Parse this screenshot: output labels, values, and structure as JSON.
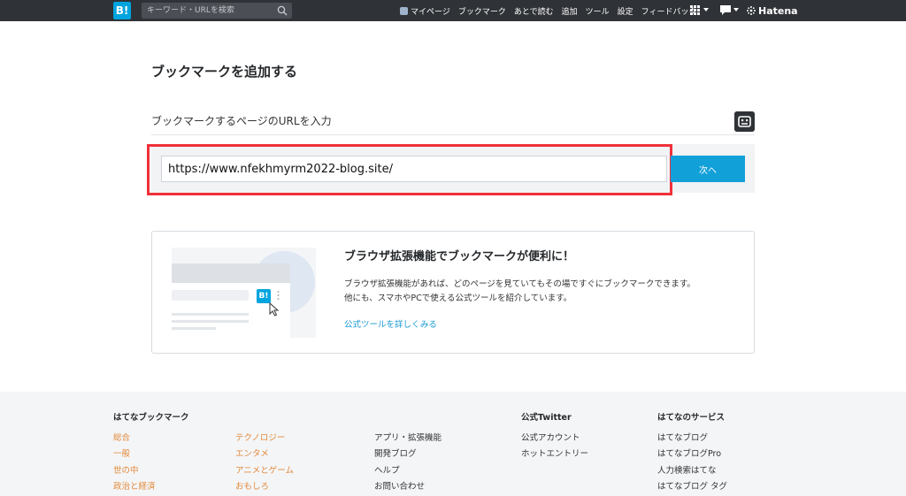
{
  "header": {
    "logo": "B!",
    "search_placeholder": "キーワード・URLを検索",
    "nav": [
      "マイページ",
      "ブックマーク",
      "あとで読む",
      "追加",
      "ツール",
      "設定",
      "フィードバック"
    ],
    "brand": "Hatena"
  },
  "main": {
    "title": "ブックマークを追加する",
    "url_label": "ブックマークするページのURLを入力",
    "url_value": "https://www.nfekhmyrm2022-blog.site/",
    "next_label": "次へ"
  },
  "promo": {
    "title": "ブラウザ拡張機能でブックマークが便利に！",
    "desc_line1": "ブラウザ拡張機能があれば、どのページを見ていてもその場ですぐにブックマークできます。",
    "desc_line2": "他にも、スマホやPCで使える公式ツールを紹介しています。",
    "link": "公式ツールを詳しくみる",
    "illust_badge": "B!"
  },
  "footer": {
    "col1_heading": "はてなブックマーク",
    "col1a": [
      "総合",
      "一般",
      "世の中",
      "政治と経済"
    ],
    "col1b": [
      "テクノロジー",
      "エンタメ",
      "アニメとゲーム",
      "おもしろ"
    ],
    "col2": [
      "アプリ・拡張機能",
      "開発ブログ",
      "ヘルプ",
      "お問い合わせ"
    ],
    "twitter_heading": "公式Twitter",
    "twitter": [
      "公式アカウント",
      "ホットエントリー"
    ],
    "services_heading": "はてなのサービス",
    "services": [
      "はてなブログ",
      "はてなブログPro",
      "人力検索はてな",
      "はてなブログ タグ"
    ]
  },
  "colors": {
    "accent": "#12a0d9",
    "highlight": "#f0303a",
    "topbar": "#2f3236",
    "category_link": "#e28a3b"
  }
}
